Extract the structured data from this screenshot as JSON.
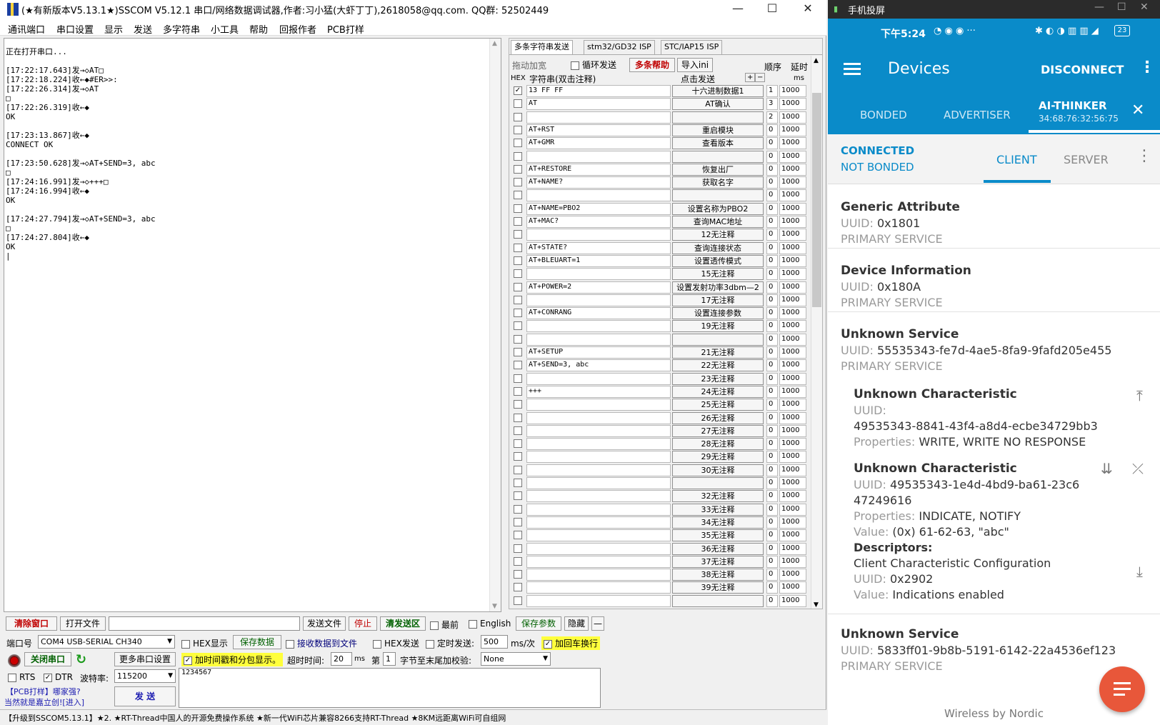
{
  "sscom": {
    "title": "(★有新版本V5.13.1★)SSCOM V5.12.1 串口/网络数据调试器,作者:习小猛(大虾丁丁),2618058@qq.com. QQ群: 52502449",
    "window_buttons": {
      "minimize": "—",
      "maximize": "☐",
      "close": "✕"
    },
    "menu": [
      "通讯端口",
      "串口设置",
      "显示",
      "发送",
      "多字符串",
      "小工具",
      "帮助",
      "回报作者",
      "PCB打样"
    ],
    "receive_lines": [
      "正在打开串口...",
      "",
      "[17:22:17.643]发→◇AT□",
      "[17:22:18.224]收←◆#ER>>:",
      "[17:22:26.314]发→◇AT",
      "□",
      "[17:22:26.319]收←◆",
      "OK",
      "",
      "[17:23:13.867]收←◆",
      "CONNECT OK",
      "",
      "[17:23:50.628]发→◇AT+SEND=3, abc",
      "□",
      "[17:24:16.991]发→◇+++□",
      "[17:24:16.994]收←◆",
      "OK",
      "",
      "[17:24:27.794]发→◇AT+SEND=3, abc",
      "□",
      "[17:24:27.804]收←◆",
      "OK",
      "|"
    ],
    "multi": {
      "tabs": [
        "多条字符串发送",
        "stm32/GD32 ISP",
        "STC/IAP15 ISP"
      ],
      "toolbar": {
        "drag": "拖动加宽",
        "loop": "循环发送",
        "help": "多条帮助",
        "import": "导入ini",
        "order": "顺序",
        "delay": "延时"
      },
      "headers": {
        "hex": "HEX",
        "str": "字符串(双击注释)",
        "click": "点击发送",
        "plus": "+",
        "minus": "−",
        "ms": "ms"
      },
      "rows": [
        {
          "checked": true,
          "str": "13 FF FF",
          "btn": "十六进制数据1",
          "ord": "1",
          "dly": "1000"
        },
        {
          "checked": false,
          "str": "AT",
          "btn": "AT确认",
          "ord": "3",
          "dly": "1000"
        },
        {
          "checked": false,
          "str": "",
          "btn": "",
          "ord": "2",
          "dly": "1000"
        },
        {
          "checked": false,
          "str": "AT+RST",
          "btn": "重启模块",
          "ord": "0",
          "dly": "1000"
        },
        {
          "checked": false,
          "str": "AT+GMR",
          "btn": "查看版本",
          "ord": "0",
          "dly": "1000"
        },
        {
          "checked": false,
          "str": "",
          "btn": "",
          "ord": "0",
          "dly": "1000"
        },
        {
          "checked": false,
          "str": "AT+RESTORE",
          "btn": "恢复出厂",
          "ord": "0",
          "dly": "1000"
        },
        {
          "checked": false,
          "str": "AT+NAME?",
          "btn": "获取名字",
          "ord": "0",
          "dly": "1000"
        },
        {
          "checked": false,
          "str": "",
          "btn": "",
          "ord": "0",
          "dly": "1000"
        },
        {
          "checked": false,
          "str": "AT+NAME=PBO2",
          "btn": "设置名称为PBO2",
          "ord": "0",
          "dly": "1000"
        },
        {
          "checked": false,
          "str": "AT+MAC?",
          "btn": "查询MAC地址",
          "ord": "0",
          "dly": "1000"
        },
        {
          "checked": false,
          "str": "",
          "btn": "12无注释",
          "ord": "0",
          "dly": "1000"
        },
        {
          "checked": false,
          "str": "AT+STATE?",
          "btn": "查询连接状态",
          "ord": "0",
          "dly": "1000"
        },
        {
          "checked": false,
          "str": "AT+BLEUART=1",
          "btn": "设置透传模式",
          "ord": "0",
          "dly": "1000"
        },
        {
          "checked": false,
          "str": "",
          "btn": "15无注释",
          "ord": "0",
          "dly": "1000"
        },
        {
          "checked": false,
          "str": "AT+POWER=2",
          "btn": "设置发射功率3dbm—2",
          "ord": "0",
          "dly": "1000"
        },
        {
          "checked": false,
          "str": "",
          "btn": "17无注释",
          "ord": "0",
          "dly": "1000"
        },
        {
          "checked": false,
          "str": "AT+CONRANG",
          "btn": "设置连接参数",
          "ord": "0",
          "dly": "1000"
        },
        {
          "checked": false,
          "str": "",
          "btn": "19无注释",
          "ord": "0",
          "dly": "1000"
        },
        {
          "checked": false,
          "str": "",
          "btn": "",
          "ord": "0",
          "dly": "1000"
        },
        {
          "checked": false,
          "str": "AT+SETUP",
          "btn": "21无注释",
          "ord": "0",
          "dly": "1000"
        },
        {
          "checked": false,
          "str": "AT+SEND=3, abc",
          "btn": "22无注释",
          "ord": "0",
          "dly": "1000"
        },
        {
          "checked": false,
          "str": "",
          "btn": "23无注释",
          "ord": "0",
          "dly": "1000"
        },
        {
          "checked": false,
          "str": "+++",
          "btn": "24无注释",
          "ord": "0",
          "dly": "1000"
        },
        {
          "checked": false,
          "str": "",
          "btn": "25无注释",
          "ord": "0",
          "dly": "1000"
        },
        {
          "checked": false,
          "str": "",
          "btn": "26无注释",
          "ord": "0",
          "dly": "1000"
        },
        {
          "checked": false,
          "str": "",
          "btn": "27无注释",
          "ord": "0",
          "dly": "1000"
        },
        {
          "checked": false,
          "str": "",
          "btn": "28无注释",
          "ord": "0",
          "dly": "1000"
        },
        {
          "checked": false,
          "str": "",
          "btn": "29无注释",
          "ord": "0",
          "dly": "1000"
        },
        {
          "checked": false,
          "str": "",
          "btn": "30无注释",
          "ord": "0",
          "dly": "1000"
        },
        {
          "checked": false,
          "str": "",
          "btn": "",
          "ord": "0",
          "dly": "1000"
        },
        {
          "checked": false,
          "str": "",
          "btn": "32无注释",
          "ord": "0",
          "dly": "1000"
        },
        {
          "checked": false,
          "str": "",
          "btn": "33无注释",
          "ord": "0",
          "dly": "1000"
        },
        {
          "checked": false,
          "str": "",
          "btn": "34无注释",
          "ord": "0",
          "dly": "1000"
        },
        {
          "checked": false,
          "str": "",
          "btn": "35无注释",
          "ord": "0",
          "dly": "1000"
        },
        {
          "checked": false,
          "str": "",
          "btn": "36无注释",
          "ord": "0",
          "dly": "1000"
        },
        {
          "checked": false,
          "str": "",
          "btn": "37无注释",
          "ord": "0",
          "dly": "1000"
        },
        {
          "checked": false,
          "str": "",
          "btn": "38无注释",
          "ord": "0",
          "dly": "1000"
        },
        {
          "checked": false,
          "str": "",
          "btn": "39无注释",
          "ord": "0",
          "dly": "1000"
        },
        {
          "checked": false,
          "str": "",
          "btn": "",
          "ord": "0",
          "dly": "1000"
        }
      ]
    },
    "bottom": {
      "clear": "清除窗口",
      "openfile": "打开文件",
      "sendfile": "发送文件",
      "stop": "停止",
      "clearsend": "清发送区",
      "last": "最前",
      "english": "English",
      "saveparam": "保存参数",
      "hide": "隐藏",
      "dash": "—",
      "port_label": "端口号",
      "port_value": "COM4 USB-SERIAL CH340",
      "hexshow": "HEX显示",
      "savedata": "保存数据",
      "recvfile": "接收数据到文件",
      "hexsend": "HEX发送",
      "timedsend": "定时发送:",
      "period": "500",
      "period_unit": "ms/次",
      "addcrlf": "加回车换行",
      "closeport": "关闭串口",
      "moreport": "更多串口设置",
      "timestamp": "加时间戳和分包显示。",
      "timeout_label": "超时时间:",
      "timeout": "20",
      "timeout_unit": "ms",
      "nth": "第",
      "byte_no": "1",
      "checksum_label": "字节至末尾加校验:",
      "checksum": "None",
      "rts": "RTS",
      "dtr": "DTR",
      "baud_label": "波特率:",
      "baud": "115200",
      "send_text": "1234567",
      "pcb1": "【PCB打样】哪家强?",
      "pcb2": "当然就是嘉立创![进入]",
      "send": "发 送",
      "status": "【升级到SSCOM5.13.1】★2. ★RT-Thread中国人的开源免费操作系统 ★新一代WiFi芯片兼容8266支持RT-Thread ★8KM远距离WiFi可自组网"
    }
  },
  "phone": {
    "window_title": "手机投屏",
    "time": "下午5:24",
    "battery": "23",
    "appbar": {
      "title": "Devices",
      "disconnect": "DISCONNECT"
    },
    "tabs": {
      "bonded": "BONDED",
      "advertiser": "ADVERTISER",
      "device_name": "AI-THINKER",
      "device_mac": "34:68:76:32:56:75"
    },
    "conn": {
      "state1": "CONNECTED",
      "state2": "NOT BONDED",
      "client": "CLIENT",
      "server": "SERVER"
    },
    "services": [
      {
        "name": "Generic Attribute",
        "uuid_label": "UUID:",
        "uuid": "0x1801",
        "type": "PRIMARY SERVICE"
      },
      {
        "name": "Device Information",
        "uuid_label": "UUID:",
        "uuid": "0x180A",
        "type": "PRIMARY SERVICE"
      },
      {
        "name": "Unknown Service",
        "uuid_label": "UUID:",
        "uuid": "55535343-fe7d-4ae5-8fa9-9fafd205e455",
        "type": "PRIMARY SERVICE"
      },
      {
        "name": "Unknown Service",
        "uuid_label": "UUID:",
        "uuid": "5833ff01-9b8b-5191-6142-22a4536ef123",
        "type": "PRIMARY SERVICE"
      }
    ],
    "char1": {
      "name": "Unknown Characteristic",
      "uuid_label": "UUID:",
      "uuid": "49535343-8841-43f4-a8d4-ecbe34729bb3",
      "props_label": "Properties:",
      "props": "WRITE, WRITE NO RESPONSE"
    },
    "char2": {
      "name": "Unknown Characteristic",
      "uuid_label": "UUID:",
      "uuid1": "49535343-1e4d-4bd9-ba61-23c6",
      "uuid2": "47249616",
      "props_label": "Properties:",
      "props": "INDICATE, NOTIFY",
      "value_label": "Value:",
      "value": "(0x) 61-62-63, \"abc\"",
      "desc_label": "Descriptors:",
      "desc_name": "Client Characteristic Configuration",
      "desc_uuid_label": "UUID:",
      "desc_uuid": "0x2902",
      "desc_value_label": "Value:",
      "desc_value": "Indications enabled"
    },
    "footer": "Wireless by Nordic",
    "colors": {
      "primary": "#0a8bc9",
      "fab": "#e8573a",
      "conn": "#0a8bc9"
    }
  }
}
